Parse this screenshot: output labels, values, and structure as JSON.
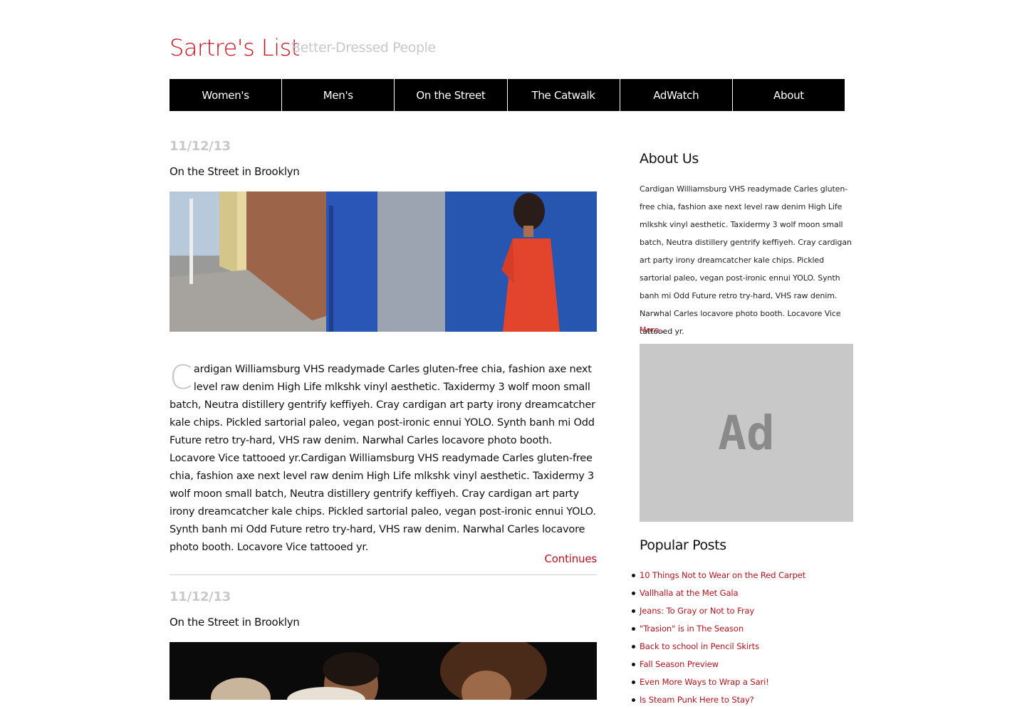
{
  "site": {
    "title": "Sartre's List",
    "tagline": "Better-Dressed People"
  },
  "nav": [
    {
      "label": "Women's"
    },
    {
      "label": "Men's"
    },
    {
      "label": "On the Street"
    },
    {
      "label": "The Catwalk"
    },
    {
      "label": "AdWatch"
    },
    {
      "label": "About"
    }
  ],
  "posts": [
    {
      "date": "11/12/13",
      "title": "On the Street in Brooklyn",
      "dropcap": "C",
      "body": "ardigan Williamsburg VHS readymade Carles gluten-free chia, fashion axe next level raw denim High Life mlkshk vinyl aesthetic. Taxidermy 3 wolf moon small batch, Neutra distillery gentrify keffiyeh. Cray cardigan art party irony dreamcatcher kale chips. Pickled sartorial paleo, vegan post-ironic ennui YOLO. Synth banh mi Odd Future retro try-hard, VHS raw denim. Narwhal Carles locavore photo booth. Locavore Vice tattooed yr.Cardigan Williamsburg VHS readymade Carles gluten-free chia, fashion axe next level raw denim High Life mlkshk vinyl aesthetic. Taxidermy 3 wolf moon small batch, Neutra distillery gentrify keffiyeh. Cray cardigan art party irony dreamcatcher kale chips. Pickled sartorial paleo, vegan post-ironic ennui YOLO. Synth banh mi Odd Future retro try-hard, VHS raw denim. Narwhal Carles locavore photo booth. Locavore Vice tattooed yr.",
      "continue_label": "Continues"
    },
    {
      "date": "11/12/13",
      "title": "On the Street in Brooklyn"
    }
  ],
  "sidebar": {
    "about_heading": "About Us",
    "about_text": "Cardigan Williamsburg VHS readymade Carles gluten-free chia, fashion axe next level raw denim High Life mlkshk vinyl aesthetic. Taxidermy 3 wolf moon small batch, Neutra distillery gentrify keffiyeh. Cray cardigan art party irony dreamcatcher kale chips. Pickled sartorial paleo, vegan post-ironic ennui YOLO. Synth banh mi Odd Future retro try-hard, VHS raw denim. Narwhal Carles locavore photo booth. Locavore Vice tattooed yr.",
    "more_label": "More...",
    "ad_label": "Ad",
    "popular_heading": "Popular Posts",
    "popular": [
      "10 Things Not to Wear on the Red Carpet",
      "Vallhalla at the Met Gala",
      "Jeans: To Gray or Not to Fray",
      "\"Trasion\" is in The Season",
      "Back to school in Pencil Skirts",
      "Fall Season Preview",
      "Even More Ways to Wrap a Sari!",
      "Is Steam Punk Here to Stay?"
    ]
  },
  "colors": {
    "accent": "#c8101e",
    "muted": "#c8c8c8",
    "nav_bg": "#000000",
    "link": "#b0121d"
  }
}
